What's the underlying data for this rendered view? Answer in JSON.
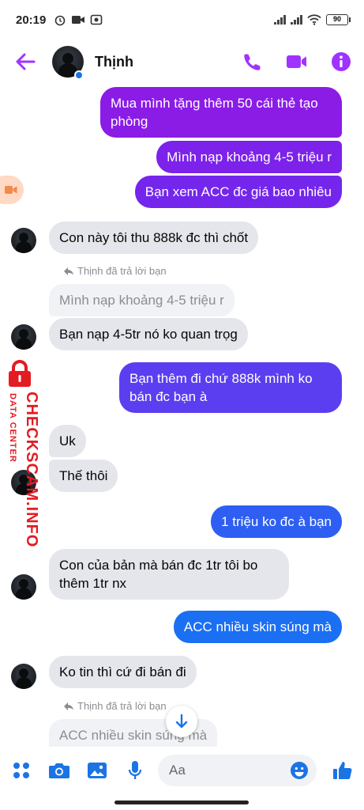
{
  "status_bar": {
    "time": "20:19",
    "battery": "90"
  },
  "header": {
    "name": "Thịnh"
  },
  "messages": {
    "m1": "Mua mình tặng thêm 50 cái thẻ tạo phòng",
    "m2": "Mình nạp khoảng 4-5 triệu r",
    "m3": "Bạn xem ACC đc giá bao nhiêu",
    "m4": "Con này tôi thu 888k đc thì chốt",
    "reply_label_1": "Thịnh đã trả lời bạn",
    "quote_1": "Mình nạp khoảng 4-5 triệu r",
    "m5": "Bạn nạp 4-5tr nó ko quan trọg",
    "m6": "Bạn thêm đi chứ 888k mình ko bán đc bạn à",
    "m7": "Uk",
    "m8": "Thế thôi",
    "m9": "1 triệu ko đc à bạn",
    "m10": "Con của bản mà bán đc 1tr tôi bo thêm 1tr nx",
    "m11": "ACC nhiều skin súng mà",
    "m12": "Ko tin thì cứ đi bán đi",
    "reply_label_2": "Thịnh đã trả lời bạn",
    "quote_2": "ACC nhiều skin súng mà"
  },
  "watermark": {
    "line1": "CHECKSCAM.INFO",
    "line2": "DATA CENTER"
  },
  "composer": {
    "placeholder": "Aa"
  },
  "colors": {
    "accent": "#a033ff",
    "purple_bubble": "#8a1ce6",
    "violet_bubble": "#5b3ef0",
    "blue_bubble": "#1b6ff2",
    "incoming_bubble": "#e4e6eb"
  },
  "icons": [
    "back-arrow-icon",
    "phone-icon",
    "video-camera-icon",
    "info-icon",
    "apps-icon",
    "camera-icon",
    "gallery-icon",
    "microphone-icon",
    "emoji-icon",
    "like-icon",
    "reply-icon",
    "arrow-down-icon"
  ]
}
